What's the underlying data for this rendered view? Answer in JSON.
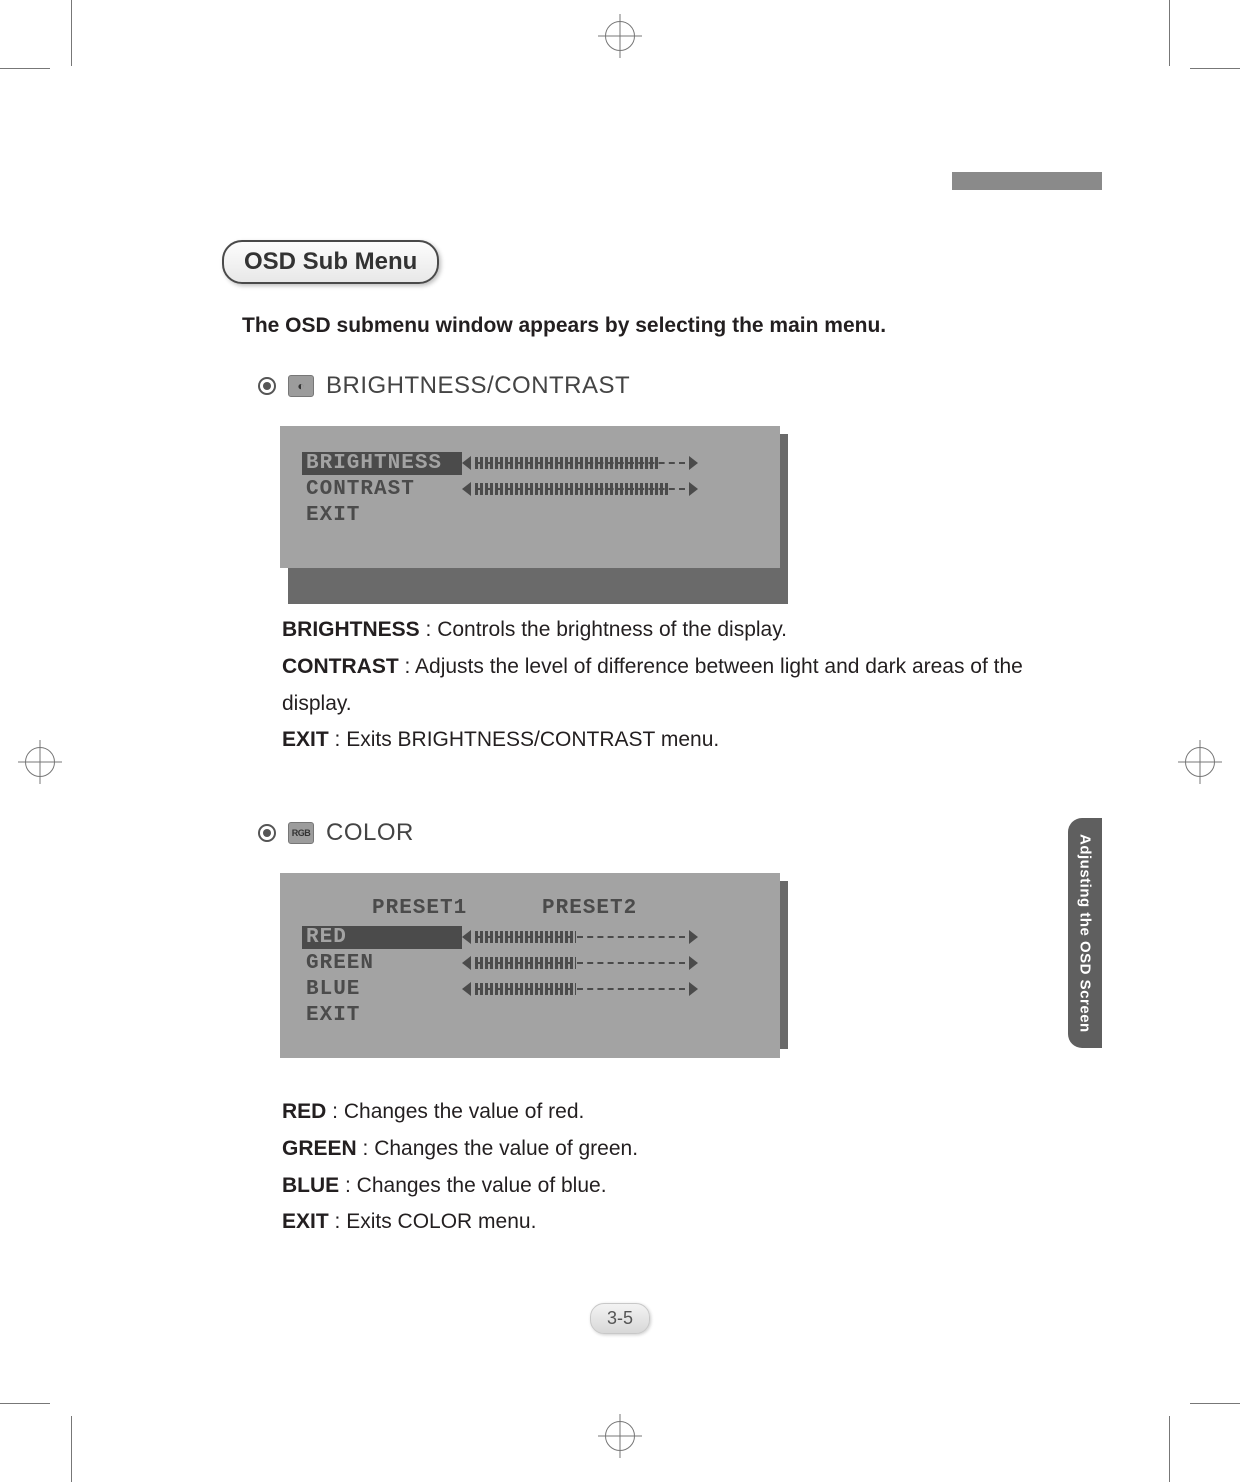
{
  "header_tab": "Adjusting the OSD Screen",
  "top_bar": true,
  "page_number": "3-5",
  "submenu_title": "OSD Sub Menu",
  "intro_text": "The OSD submenu window appears by selecting the main menu.",
  "sections": {
    "brightness": {
      "icon_label": "◐",
      "title": "BRIGHTNESS/CONTRAST",
      "osd": {
        "rows": [
          {
            "label": "BRIGHTNESS",
            "selected": true,
            "value_pct": 88
          },
          {
            "label": "CONTRAST",
            "selected": false,
            "value_pct": 92
          },
          {
            "label": "EXIT",
            "selected": false,
            "value_pct": null
          }
        ]
      },
      "descriptions": [
        {
          "term": "BRIGHTNESS",
          "text": " : Controls the brightness of the display."
        },
        {
          "term": "CONTRAST",
          "text": " : Adjusts the level of difference between light and dark areas of the display."
        },
        {
          "term": "EXIT",
          "text": " : Exits BRIGHTNESS/CONTRAST menu."
        }
      ]
    },
    "color": {
      "icon_label": "RGB",
      "title": "COLOR",
      "osd": {
        "presets": [
          "PRESET1",
          "PRESET2"
        ],
        "rows": [
          {
            "label": "RED",
            "selected": true,
            "value_pct": 48
          },
          {
            "label": "GREEN",
            "selected": false,
            "value_pct": 48
          },
          {
            "label": "BLUE",
            "selected": false,
            "value_pct": 48
          },
          {
            "label": "EXIT",
            "selected": false,
            "value_pct": null
          }
        ]
      },
      "descriptions": [
        {
          "term": "RED",
          "text": " : Changes the value of red."
        },
        {
          "term": "GREEN",
          "text": " : Changes the value of green."
        },
        {
          "term": "BLUE",
          "text": " : Changes the value of blue."
        },
        {
          "term": "EXIT",
          "text": " : Exits COLOR menu."
        }
      ]
    }
  }
}
